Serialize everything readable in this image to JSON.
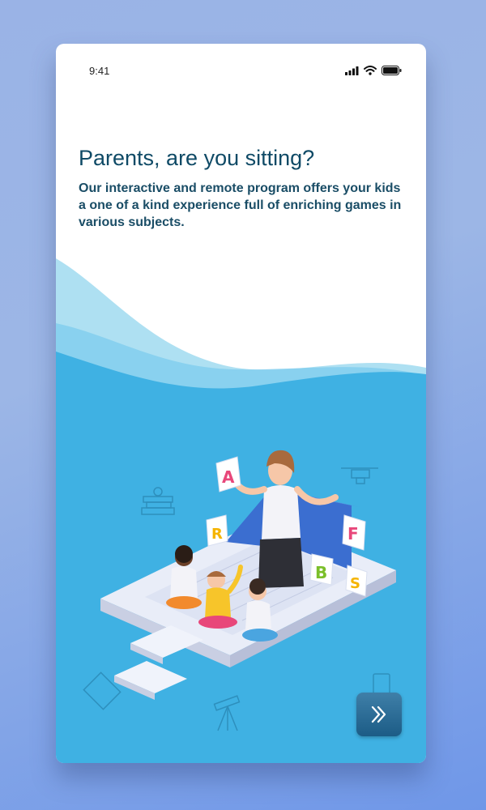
{
  "status_bar": {
    "time": "9:41",
    "icons": [
      "signal-icon",
      "wifi-icon",
      "battery-icon"
    ]
  },
  "onboarding": {
    "title": "Parents, are you sitting?",
    "description": "Our interactive and remote program offers your kids a one of a kind experience full of enriching games in various subjects.",
    "next_button_icon": "double-chevron-right-icon"
  },
  "illustration": {
    "letter_cards": [
      "A",
      "R",
      "F",
      "B",
      "S"
    ]
  },
  "colors": {
    "background": "#9cb6e6",
    "wave_light": "#aee0f2",
    "wave_main": "#3fb1e3",
    "title": "#0f4a66",
    "button": "#2a6b93"
  }
}
